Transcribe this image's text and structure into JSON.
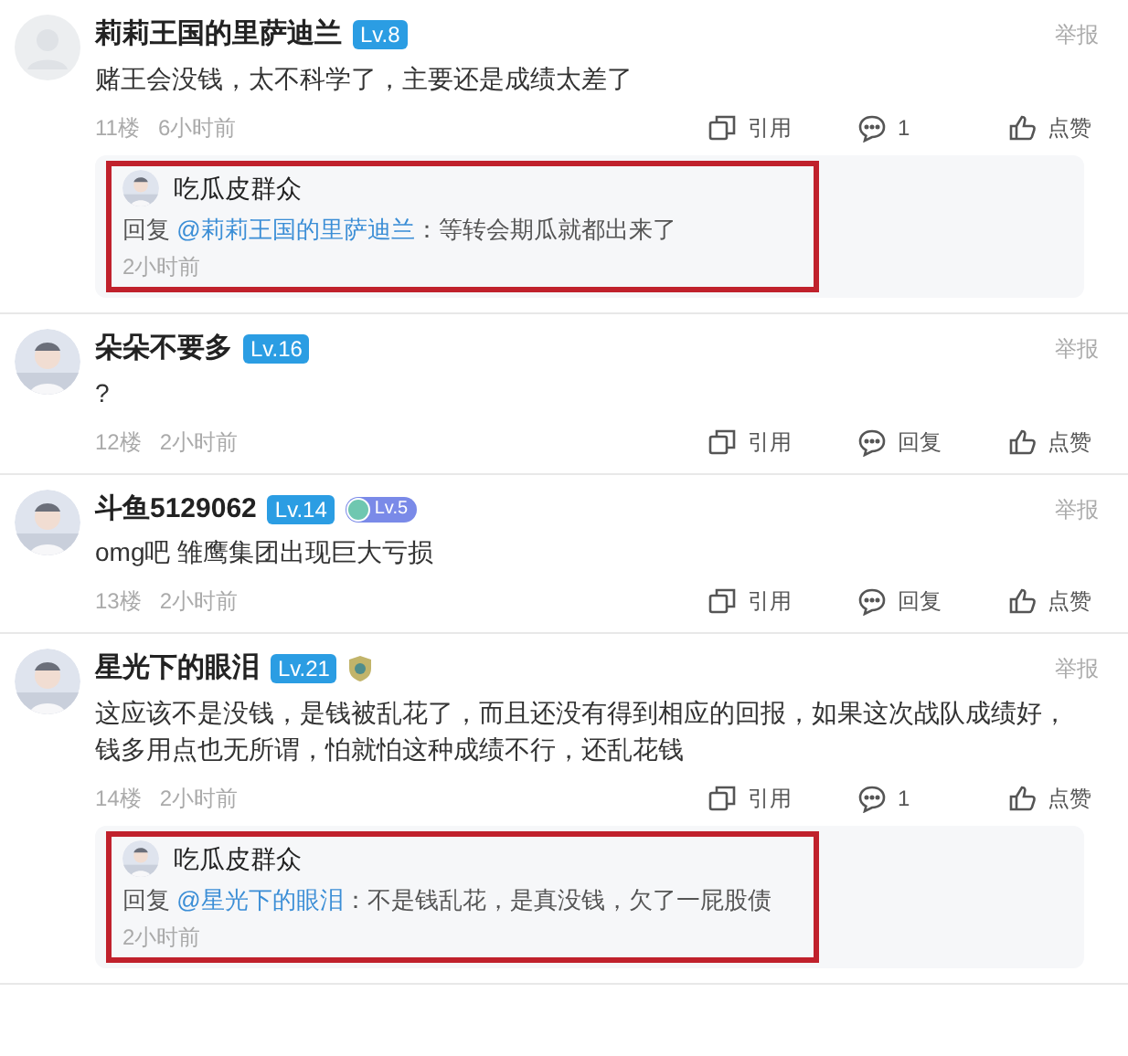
{
  "comments": [
    {
      "avatar": {
        "kind": "default"
      },
      "name": "莉莉王国的里萨迪兰",
      "badges": [
        {
          "kind": "level",
          "text": "Lv.8"
        }
      ],
      "report": "举报",
      "text": "赌王会没钱，太不科学了，主要还是成绩太差了",
      "floor": "11楼",
      "time": "6小时前",
      "actions": [
        {
          "kind": "quote",
          "label": "引用"
        },
        {
          "kind": "reply",
          "label": "1"
        },
        {
          "kind": "like",
          "label": "点赞"
        }
      ],
      "replies": [
        {
          "name": "吃瓜皮群众",
          "prefix": "回复",
          "mention": "@莉莉王国的里萨迪兰",
          "text": "：等转会期瓜就都出来了",
          "time": "2小时前",
          "highlighted": true
        }
      ]
    },
    {
      "avatar": {
        "kind": "picture"
      },
      "name": "朵朵不要多",
      "badges": [
        {
          "kind": "level",
          "text": "Lv.16"
        }
      ],
      "report": "举报",
      "text": "?",
      "floor": "12楼",
      "time": "2小时前",
      "actions": [
        {
          "kind": "quote",
          "label": "引用"
        },
        {
          "kind": "reply",
          "label": "回复"
        },
        {
          "kind": "like",
          "label": "点赞"
        }
      ]
    },
    {
      "avatar": {
        "kind": "picture"
      },
      "name": "斗鱼5129062",
      "badges": [
        {
          "kind": "level",
          "text": "Lv.14"
        },
        {
          "kind": "fan",
          "text": "Lv.5"
        }
      ],
      "report": "举报",
      "text": "omg吧 雏鹰集团出现巨大亏损",
      "floor": "13楼",
      "time": "2小时前",
      "actions": [
        {
          "kind": "quote",
          "label": "引用"
        },
        {
          "kind": "reply",
          "label": "回复"
        },
        {
          "kind": "like",
          "label": "点赞"
        }
      ]
    },
    {
      "avatar": {
        "kind": "picture"
      },
      "name": "星光下的眼泪",
      "badges": [
        {
          "kind": "level",
          "text": "Lv.21"
        },
        {
          "kind": "shield"
        }
      ],
      "report": "举报",
      "text": "这应该不是没钱，是钱被乱花了，而且还没有得到相应的回报，如果这次战队成绩好，钱多用点也无所谓，怕就怕这种成绩不行，还乱花钱",
      "floor": "14楼",
      "time": "2小时前",
      "actions": [
        {
          "kind": "quote",
          "label": "引用"
        },
        {
          "kind": "reply",
          "label": "1"
        },
        {
          "kind": "like",
          "label": "点赞"
        }
      ],
      "replies": [
        {
          "name": "吃瓜皮群众",
          "prefix": "回复",
          "mention": "@星光下的眼泪",
          "text": "：不是钱乱花，是真没钱，欠了一屁股债",
          "time": "2小时前",
          "highlighted": true
        }
      ]
    }
  ]
}
